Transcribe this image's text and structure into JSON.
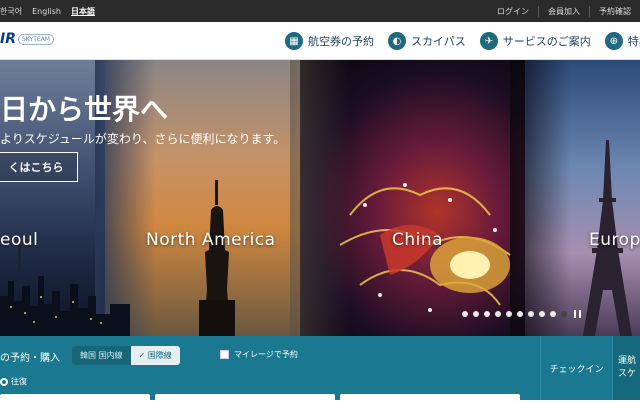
{
  "topbar": {
    "languages": [
      "한국어",
      "English",
      "日本語"
    ],
    "active_language": "日本語",
    "links": [
      "ログイン",
      "会員加入",
      "予約確認"
    ]
  },
  "nav": {
    "logo_text": "IR",
    "logo_tag": "SKYTEAM",
    "items": [
      {
        "label": "航空券の予約",
        "icon": "calendar-icon"
      },
      {
        "label": "スカイパス",
        "icon": "skypass-icon"
      },
      {
        "label": "サービスのご案内",
        "icon": "plane-icon"
      },
      {
        "label": "特典",
        "icon": "globe-icon"
      }
    ]
  },
  "hero": {
    "headline": "日から世界へ",
    "subline": "よりスケジュールが変わり、さらに便利になります。",
    "cta_label": "くはこちら",
    "destinations": [
      "eoul",
      "North America",
      "China",
      "Europ"
    ],
    "slide_count": 10,
    "active_slide": 10
  },
  "booking": {
    "title": "の予約・購入",
    "segment": {
      "option_1": "韓国 国内線",
      "option_2": "✓ 国際線"
    },
    "mileage_label": "マイレージで予約",
    "trip_type": "往復",
    "tabs": [
      "チェックイン",
      "運航\nスケ"
    ]
  },
  "colors": {
    "accent": "#1a7890",
    "topbar": "#2b2b2b",
    "brand": "#0b3a8c"
  }
}
